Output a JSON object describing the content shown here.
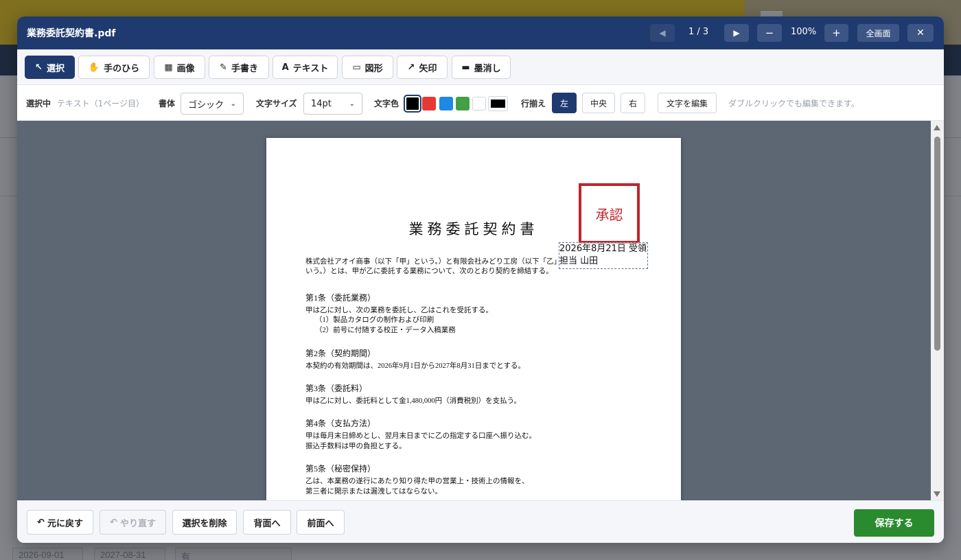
{
  "background": {
    "bottom_cells": [
      "2026-09-01",
      "2027-08-31",
      "有"
    ]
  },
  "modal": {
    "title": "業務委託契約書.pdf",
    "page_indicator": "1 / 3",
    "zoom": "100%",
    "prev_page": "◀",
    "next_page": "▶",
    "zoom_out": "−",
    "zoom_in": "+",
    "fullscreen": "全画面",
    "close": "✕"
  },
  "tools": [
    {
      "label": "選択",
      "icon": "↖"
    },
    {
      "label": "手のひら",
      "icon": "✋"
    },
    {
      "label": "画像",
      "icon": "▦"
    },
    {
      "label": "手書き",
      "icon": "✎"
    },
    {
      "label": "テキスト",
      "icon": "A"
    },
    {
      "label": "図形",
      "icon": "▭"
    },
    {
      "label": "矢印",
      "icon": "↗"
    },
    {
      "label": "墨消し",
      "icon": "▬"
    }
  ],
  "props": {
    "selected_label": "選択中",
    "selected_value": "テキスト（1ページ目）",
    "font_label": "書体",
    "font_value": "ゴシック",
    "size_label": "文字サイズ",
    "size_value": "14pt",
    "color_label": "文字色",
    "colors": [
      "#000000",
      "#e53935",
      "#1e88e5",
      "#43a047",
      "#ffffff"
    ],
    "custom_color": "#000000",
    "align_label": "行揃え",
    "align_left": "左",
    "align_center": "中央",
    "align_right": "右",
    "edit_text": "文字を編集",
    "hint": "ダブルクリックでも編集できます。"
  },
  "document": {
    "title": "業務委託契約書",
    "stamp": "承認",
    "textbox_line1": "2026年8月21日 受領",
    "textbox_line2": "担当 山田",
    "intro_line1": "株式会社アオイ商事（以下「甲」という。）と有限会社みどり工房（以下「乙」と",
    "intro_line2": "いう。）とは、甲が乙に委託する業務について、次のとおり契約を締結する。",
    "art1_title": "第1条（委託業務）",
    "art1_line1": "甲は乙に対し、次の業務を委託し、乙はこれを受託する。",
    "art1_item1": "（1）製品カタログの制作および印刷",
    "art1_item2": "（2）前号に付随する校正・データ入稿業務",
    "art2_title": "第2条（契約期間）",
    "art2_line1": "本契約の有効期間は、2026年9月1日から2027年8月31日までとする。",
    "art3_title": "第3条（委託料）",
    "art3_line1": "甲は乙に対し、委託料として金1,480,000円（消費税別）を支払う。",
    "art4_title": "第4条（支払方法）",
    "art4_line1": "甲は毎月末日締めとし、翌月末日までに乙の指定する口座へ振り込む。",
    "art4_line2": "振込手数料は甲の負担とする。",
    "art5_title": "第5条（秘密保持）",
    "art5_line1": "乙は、本業務の遂行にあたり知り得た甲の営業上・技術上の情報を、",
    "art5_line2": "第三者に開示または漏洩してはならない。"
  },
  "footer": {
    "undo": "元に戻す",
    "redo": "やり直す",
    "delete": "選択を削除",
    "send_back": "背面へ",
    "bring_front": "前面へ",
    "save": "保存する"
  },
  "colors": {
    "header": "#1f3a6e",
    "save": "#2a8a2e",
    "stamp": "#c2242b"
  }
}
